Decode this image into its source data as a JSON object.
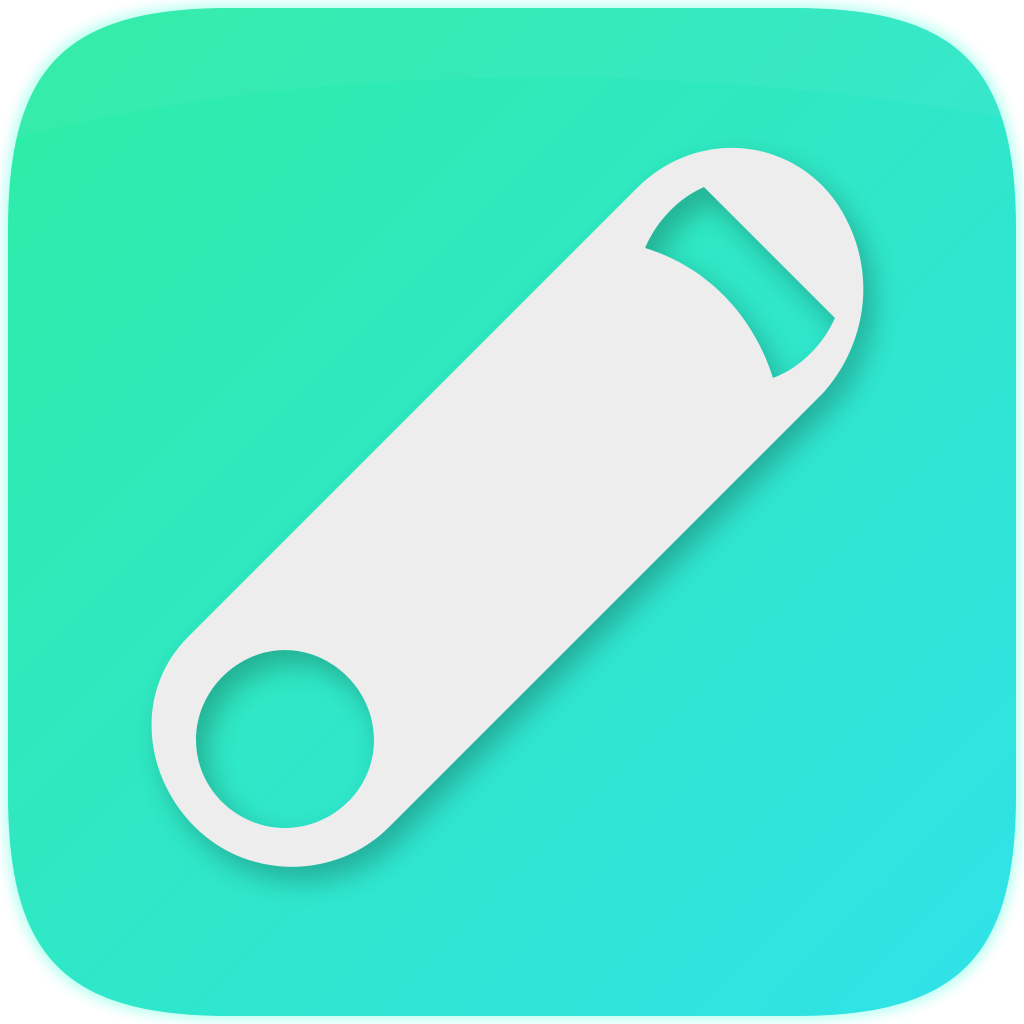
{
  "app_icon": {
    "icon_name": "bottle-opener-icon",
    "colors": {
      "gradient_start": "#2EEDA4",
      "gradient_end": "#30E2EA",
      "edge_highlight": "#7DFFE6",
      "glyph": "#EDEDED",
      "shadow": "#0B8F7A"
    }
  }
}
